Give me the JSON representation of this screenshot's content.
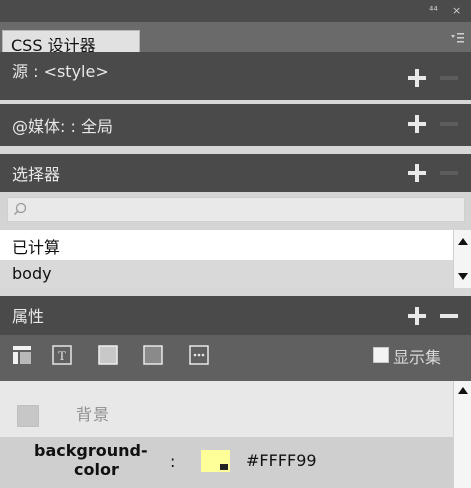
{
  "window": {
    "collapse_glyph": "⁴⁴",
    "close_glyph": "×"
  },
  "panel": {
    "tab_label": "CSS 设计器",
    "menu_icon": "panel-menu-icon"
  },
  "sections": [
    {
      "title": "源 : <style>"
    },
    {
      "title": "@媒体: : 全局"
    },
    {
      "title": "选择器"
    },
    {
      "title": "属性"
    }
  ],
  "selectors": {
    "search_placeholder": "",
    "items": [
      "已计算",
      "body"
    ]
  },
  "properties": {
    "show_set_label": "显示集",
    "background_section_label": "背景",
    "background_color": {
      "name_line1": "background-",
      "name_line2": "color",
      "colon": ":",
      "value": "#FFFF99",
      "swatch": "#ffff99"
    }
  }
}
